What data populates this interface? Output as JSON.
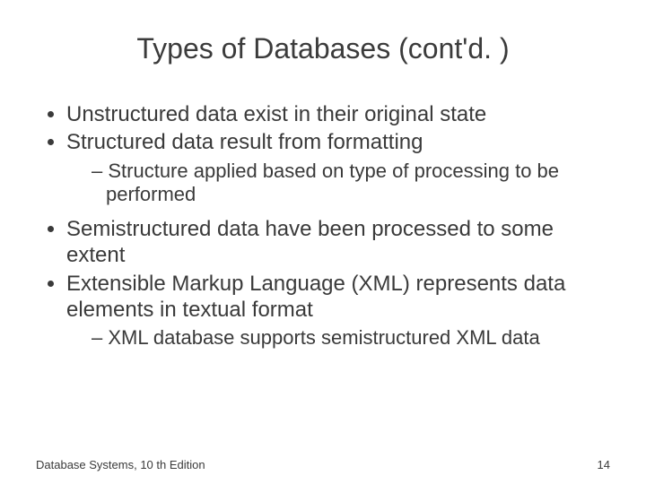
{
  "title": "Types of Databases (cont'd. )",
  "bullets": {
    "b1": "Unstructured data exist in their original state",
    "b2": "Structured data result from formatting",
    "b2_sub1": "Structure applied based on type of processing to be performed",
    "b3": "Semistructured data have been processed to some extent",
    "b4": "Extensible Markup Language (XML) represents data elements in textual format",
    "b4_sub1": "XML database supports semistructured XML data"
  },
  "footer": {
    "left": "Database Systems, 10 th Edition",
    "right": "14"
  }
}
